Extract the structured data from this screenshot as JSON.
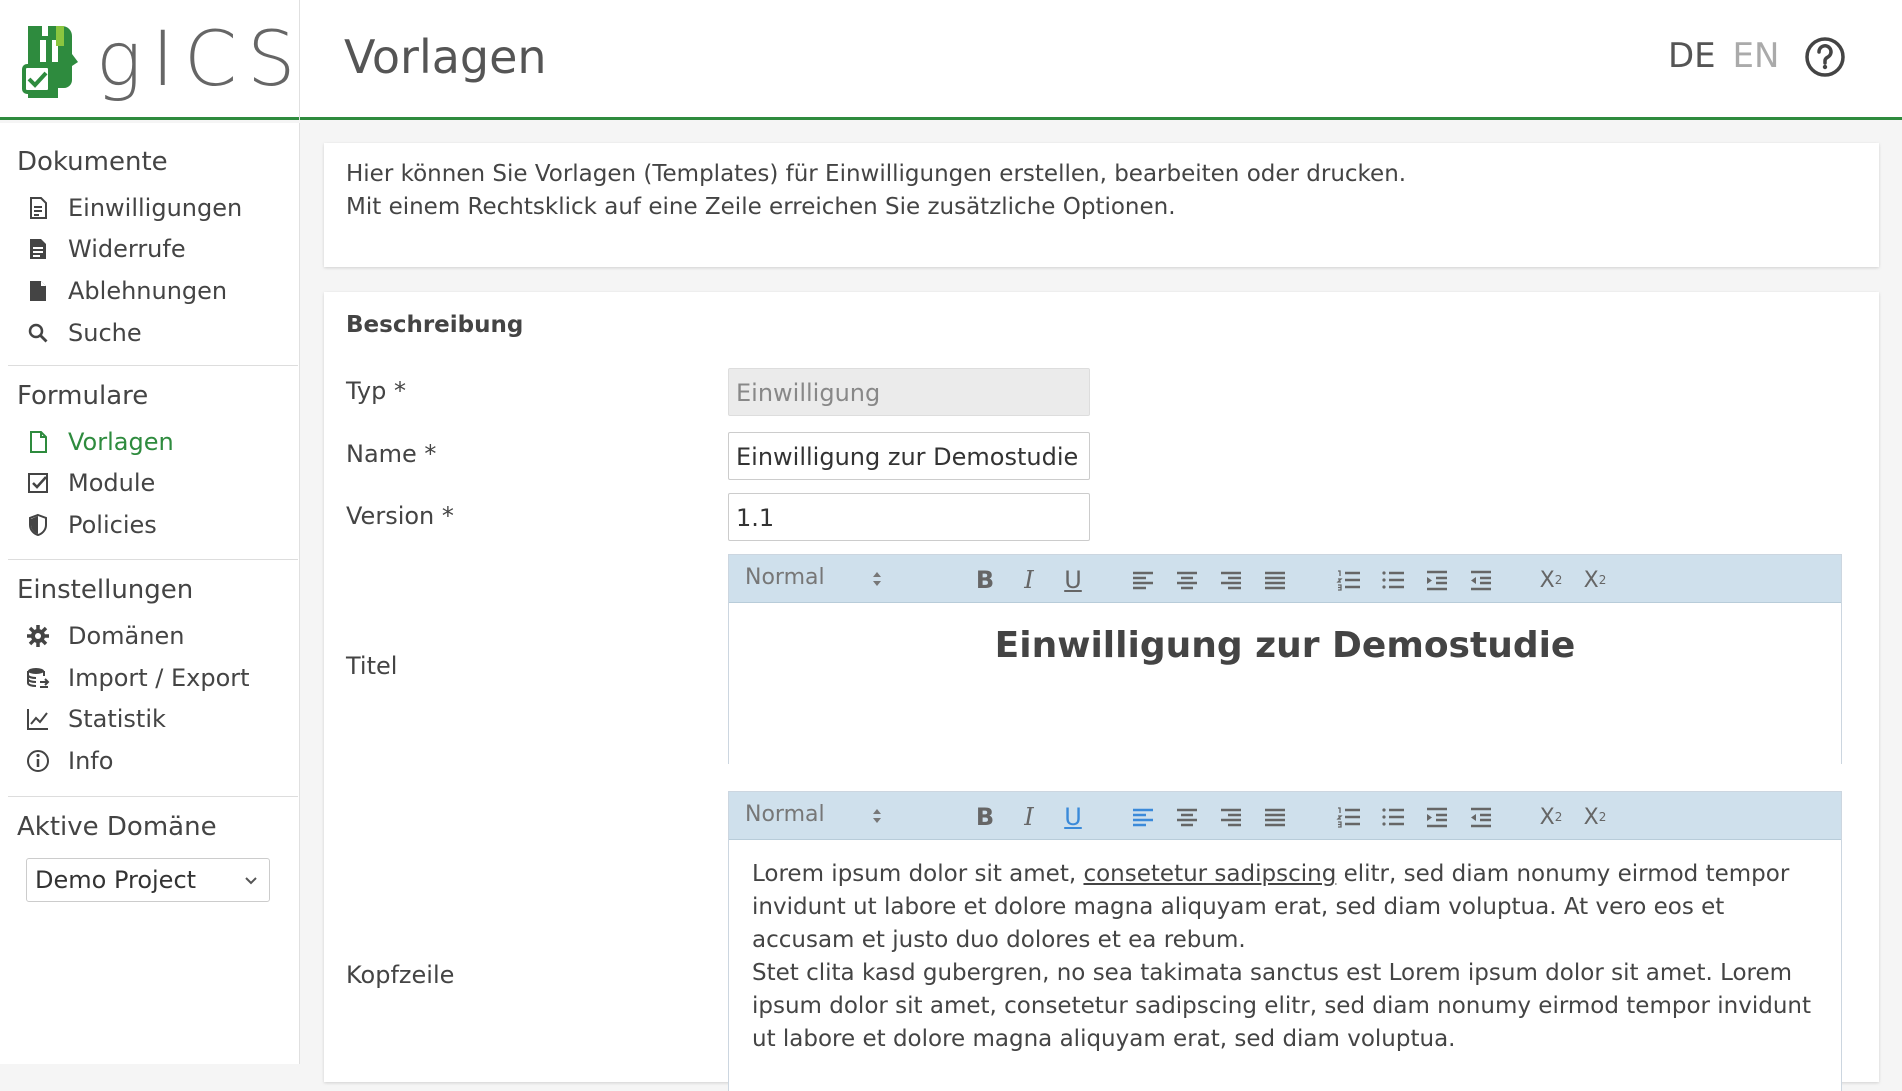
{
  "header": {
    "logo_text": "gICS",
    "title": "Vorlagen",
    "lang_de": "DE",
    "lang_en": "EN",
    "brand_color": "#2e8b3e"
  },
  "sidebar": {
    "sections": [
      {
        "title": "Dokumente",
        "items": [
          {
            "label": "Einwilligungen",
            "icon": "document-lines-icon"
          },
          {
            "label": "Widerrufe",
            "icon": "document-filled-icon"
          },
          {
            "label": "Ablehnungen",
            "icon": "document-blank-icon"
          },
          {
            "label": "Suche",
            "icon": "search-icon"
          }
        ]
      },
      {
        "title": "Formulare",
        "items": [
          {
            "label": "Vorlagen",
            "icon": "document-outline-icon",
            "active": true
          },
          {
            "label": "Module",
            "icon": "checkbox-icon"
          },
          {
            "label": "Policies",
            "icon": "shield-icon"
          }
        ]
      },
      {
        "title": "Einstellungen",
        "items": [
          {
            "label": "Domänen",
            "icon": "gear-icon"
          },
          {
            "label": "Import / Export",
            "icon": "database-icon"
          },
          {
            "label": "Statistik",
            "icon": "line-chart-icon"
          },
          {
            "label": "Info",
            "icon": "info-icon"
          }
        ]
      }
    ],
    "active_domain": {
      "title": "Aktive Domäne",
      "value": "Demo Project"
    }
  },
  "info": {
    "line1": "Hier können Sie Vorlagen (Templates) für Einwilligungen erstellen, bearbeiten oder drucken.",
    "line2": "Mit einem Rechtsklick auf eine Zeile erreichen Sie zusätzliche Optionen."
  },
  "form": {
    "section": "Beschreibung",
    "typ_label": "Typ  *",
    "typ_value": "Einwilligung",
    "name_label": "Name  *",
    "name_value": "Einwilligung zur Demostudie",
    "version_label": "Version  *",
    "version_value": "1.1",
    "titel_label": "Titel",
    "kopfzeile_label": "Kopfzeile",
    "toolbar_format": "Normal",
    "title_content": "Einwilligung zur Demostudie",
    "kopf_p1_a": "Lorem ipsum dolor sit amet, ",
    "kopf_p1_link": "consetetur sadipscing",
    "kopf_p1_b": " elitr, sed diam nonumy eirmod tempor invidunt ut labore et dolore magna aliquyam erat, sed diam voluptua. At vero eos et accusam et justo duo dolores et ea rebum.",
    "kopf_p2": "Stet clita kasd gubergren, no sea takimata sanctus est Lorem ipsum dolor sit amet. Lorem ipsum dolor sit amet, consetetur sadipscing elitr, sed diam nonumy eirmod tempor invidunt ut labore et dolore magna aliquyam erat, sed diam voluptua."
  }
}
